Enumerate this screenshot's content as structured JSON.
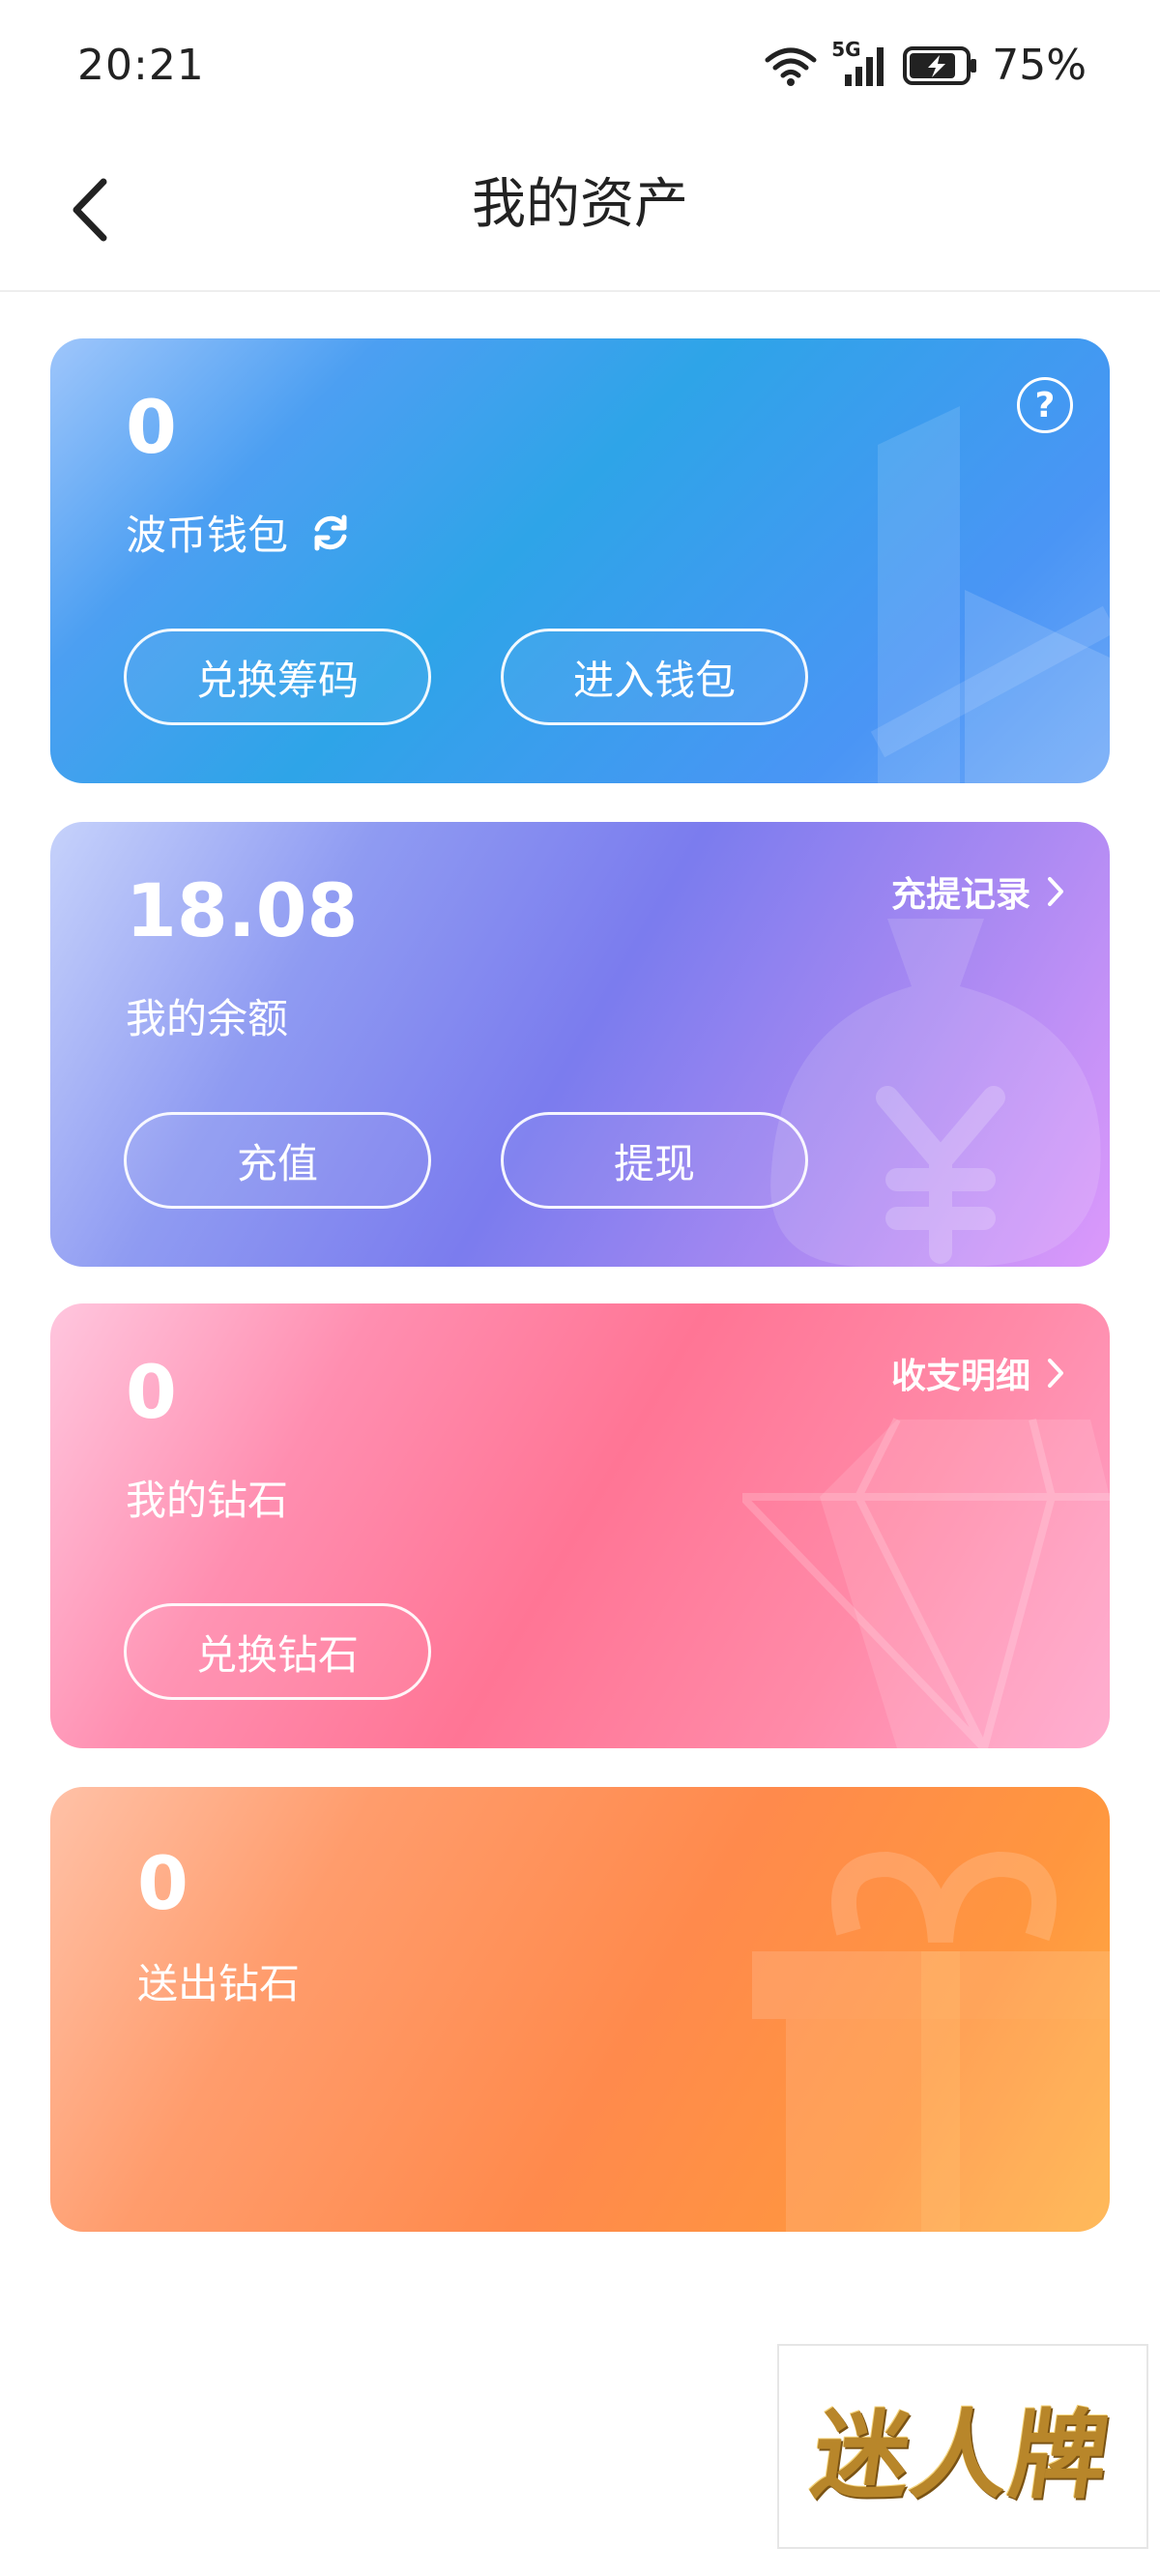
{
  "status_bar": {
    "time": "20:21",
    "network": "5G",
    "battery": "75%"
  },
  "header": {
    "title": "我的资产"
  },
  "cards": {
    "bobi_wallet": {
      "value": "0",
      "label": "波币钱包",
      "buttons": [
        "兑换筹码",
        "进入钱包"
      ],
      "color": "#3d9ef0"
    },
    "balance": {
      "value": "18.08",
      "label": "我的余额",
      "link": "充提记录",
      "buttons": [
        "充值",
        "提现"
      ],
      "color": "#7f7eee"
    },
    "diamonds": {
      "value": "0",
      "label": "我的钻石",
      "link": "收支明细",
      "buttons": [
        "兑换钻石"
      ],
      "color": "#ff7a9a"
    },
    "sent_diamonds": {
      "value": "0",
      "label": "送出钻石",
      "color": "#ff8f4a"
    }
  },
  "watermark": {
    "text": "迷人牌"
  }
}
